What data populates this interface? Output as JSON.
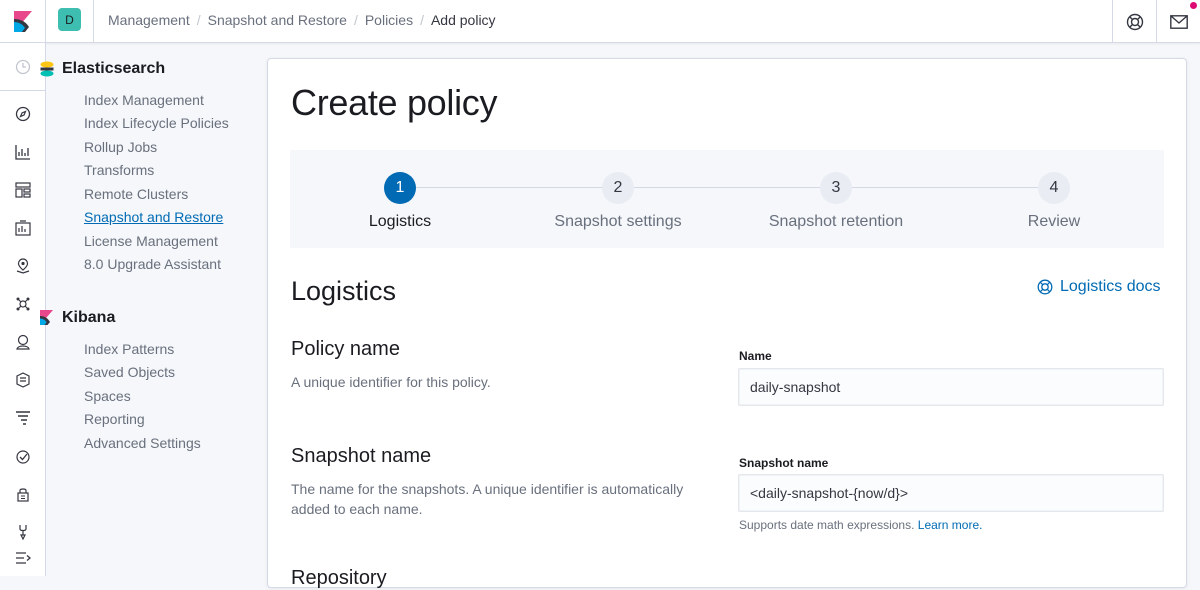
{
  "header": {
    "space_initial": "D",
    "breadcrumbs": [
      "Management",
      "Snapshot and Restore",
      "Policies",
      "Add policy"
    ]
  },
  "sidebar": {
    "groups": [
      {
        "title": "Elasticsearch",
        "items": [
          "Index Management",
          "Index Lifecycle Policies",
          "Rollup Jobs",
          "Transforms",
          "Remote Clusters",
          "Snapshot and Restore",
          "License Management",
          "8.0 Upgrade Assistant"
        ]
      },
      {
        "title": "Kibana",
        "items": [
          "Index Patterns",
          "Saved Objects",
          "Spaces",
          "Reporting",
          "Advanced Settings"
        ]
      }
    ],
    "active_item": "Snapshot and Restore"
  },
  "page": {
    "title": "Create policy",
    "steps": [
      {
        "number": "1",
        "label": "Logistics",
        "current": true
      },
      {
        "number": "2",
        "label": "Snapshot settings",
        "current": false
      },
      {
        "number": "3",
        "label": "Snapshot retention",
        "current": false
      },
      {
        "number": "4",
        "label": "Review",
        "current": false
      }
    ],
    "section_title": "Logistics",
    "docs_link": "Logistics docs",
    "fields": {
      "policy_name": {
        "title": "Policy name",
        "description": "A unique identifier for this policy.",
        "label": "Name",
        "value": "daily-snapshot"
      },
      "snapshot_name": {
        "title": "Snapshot name",
        "description": "The name for the snapshots. A unique identifier is automatically added to each name.",
        "label": "Snapshot name",
        "value": "<daily-snapshot-{now/d}>",
        "help": "Supports date math expressions.",
        "help_link": "Learn more."
      }
    },
    "next_section_partial": "Repository"
  },
  "colors": {
    "primary": "#006bb4",
    "space_avatar": "#3ebeb0",
    "notification": "#dd0a73"
  }
}
